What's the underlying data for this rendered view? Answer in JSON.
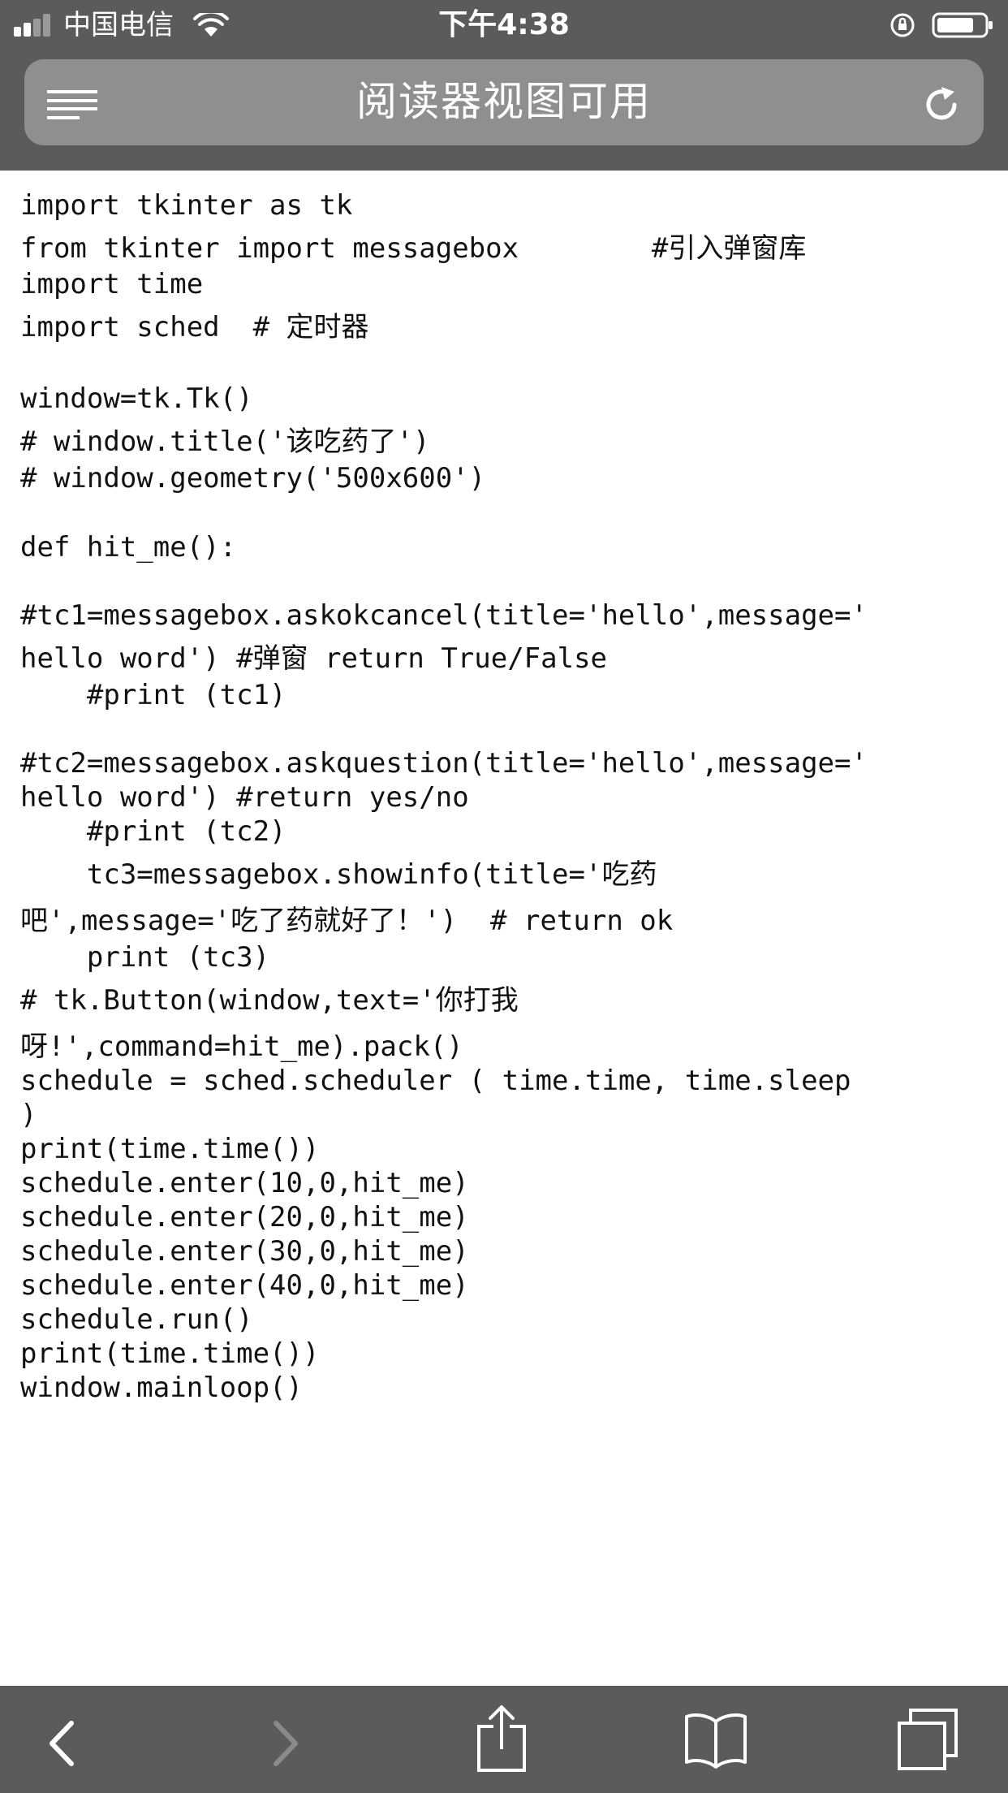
{
  "status_bar": {
    "carrier": "中国电信",
    "time": "下午4:38",
    "icons": [
      "signal-icon",
      "wifi-icon",
      "orientation-lock-icon",
      "battery-icon"
    ]
  },
  "toolbar": {
    "title": "阅读器视图可用",
    "icons": [
      "reader-menu-icon",
      "reload-icon"
    ]
  },
  "code_lines": [
    "import tkinter as tk",
    "from tkinter import messagebox        #引入弹窗库",
    "import time",
    "import sched  # 定时器",
    "window=tk.Tk()",
    "# window.title('该吃药了')",
    "# window.geometry('500x600')",
    "def hit_me():",
    "#tc1=messagebox.askokcancel(title='hello',message='",
    "hello word') #弹窗 return True/False",
    "    #print (tc1)",
    "#tc2=messagebox.askquestion(title='hello',message='",
    "hello word') #return yes/no",
    "    #print (tc2)",
    "    tc3=messagebox.showinfo(title='吃药",
    "吧',message='吃了药就好了！')  # return ok",
    "    print (tc3)",
    "# tk.Button(window,text='你打我",
    "呀!',command=hit_me).pack()",
    "schedule = sched.scheduler ( time.time, time.sleep",
    ")",
    "print(time.time())",
    "schedule.enter(10,0,hit_me)",
    "schedule.enter(20,0,hit_me)",
    "schedule.enter(30,0,hit_me)",
    "schedule.enter(40,0,hit_me)",
    "schedule.run()",
    "print(time.time())",
    "window.mainloop()"
  ],
  "bottom_bar": {
    "icons": [
      "back-icon",
      "forward-icon",
      "share-icon",
      "bookmarks-icon",
      "tabs-icon"
    ],
    "forward_enabled": false
  },
  "colors": {
    "chrome": "#5b5b5b",
    "address_pill": "#8f8f8f",
    "text": "#111111",
    "disabled_icon": "#8a8a8a"
  }
}
